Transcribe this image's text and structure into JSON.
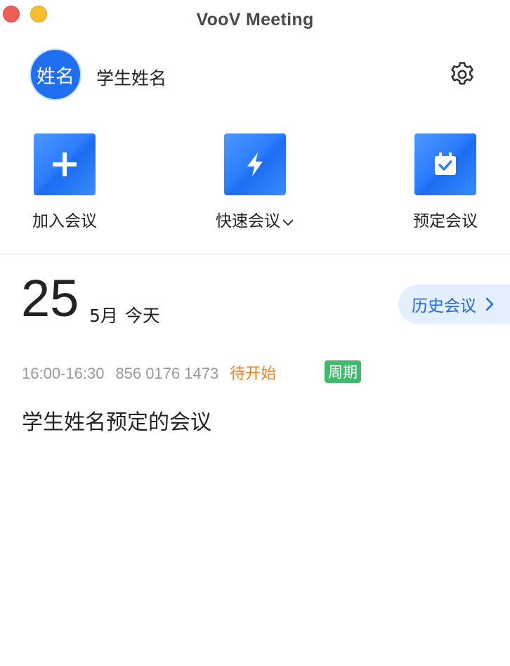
{
  "window": {
    "title": "VooV Meeting"
  },
  "profile": {
    "avatar_text": "姓名",
    "user_name": "学生姓名"
  },
  "actions": {
    "join": {
      "label": "加入会议",
      "icon": "plus-icon"
    },
    "quick": {
      "label": "快速会议",
      "icon": "lightning-icon"
    },
    "schedule": {
      "label": "预定会议",
      "icon": "calendar-check-icon"
    }
  },
  "date_header": {
    "day": "25",
    "month": "5月",
    "today": "今天",
    "history_label": "历史会议"
  },
  "meetings": [
    {
      "time": "16:00-16:30",
      "meeting_id": "856 0176 1473",
      "status": "待开始",
      "tag": "周期",
      "title": "学生姓名预定的会议"
    }
  ],
  "colors": {
    "accent_blue": "#1f6ff0",
    "status_orange": "#ee7d27",
    "tag_green": "#3dbb6b",
    "history_bg": "#e3eefe"
  }
}
